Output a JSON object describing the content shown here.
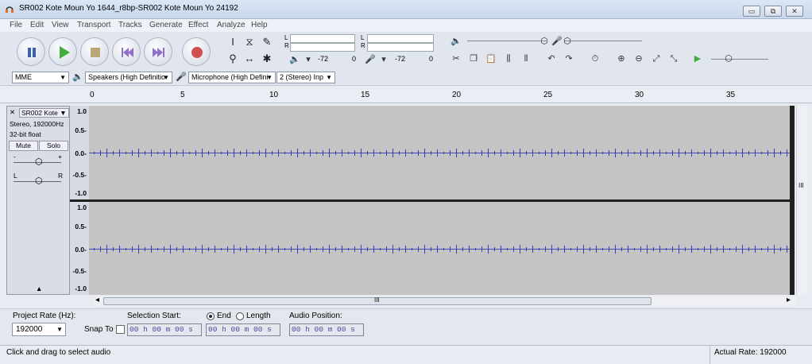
{
  "window": {
    "title": "SR002 Kote Moun Yo 1644_r8bp-SR002 Kote Moun Yo 24192",
    "minimize": "▭",
    "restore": "⧉",
    "close": "✕"
  },
  "menu": [
    "File",
    "Edit",
    "View",
    "Transport",
    "Tracks",
    "Generate",
    "Effect",
    "Analyze",
    "Help"
  ],
  "meters": {
    "play_L": "L",
    "play_R": "R",
    "rec_L": "L",
    "rec_R": "R",
    "play_db": "-72",
    "play_zero": "0",
    "rec_db": "-72",
    "rec_zero": "0"
  },
  "device": {
    "host": "MME",
    "output": "Speakers (High Definitio",
    "input": "Microphone (High Defini",
    "channels": "2 (Stereo) Inp"
  },
  "ruler": {
    "ticks": [
      "0",
      "5",
      "10",
      "15",
      "20",
      "25",
      "30",
      "35"
    ]
  },
  "track": {
    "name": "SR002 Kote",
    "info1": "Stereo, 192000Hz",
    "info2": "32-bit float",
    "mute": "Mute",
    "solo": "Solo",
    "gain_minus": "-",
    "gain_plus": "+",
    "pan_left": "L",
    "pan_right": "R",
    "collapse": "▲",
    "close": "✕",
    "menu_arrow": "▼"
  },
  "vscale": [
    "1.0",
    "0.5-",
    "0.0-",
    "-0.5-",
    "-1.0"
  ],
  "scroll": {
    "grip": "III",
    "left": "◂",
    "right": "▸",
    "up": "▴",
    "down": "▾"
  },
  "selection": {
    "project_rate_label": "Project Rate (Hz):",
    "project_rate": "192000",
    "snap_to": "Snap To",
    "selection_start_label": "Selection Start:",
    "end_label": "End",
    "length_label": "Length",
    "audio_position_label": "Audio Position:",
    "start_time": "00 h 00 m 00 s",
    "end_time": "00 h 00 m 00 s",
    "audio_time": "00 h 00 m 00 s"
  },
  "status": {
    "left": "Click and drag to select audio",
    "right": "Actual Rate: 192000"
  },
  "colors": {
    "waveform": "#3a3ab8",
    "record": "#d05050",
    "play": "#3fae3f"
  }
}
